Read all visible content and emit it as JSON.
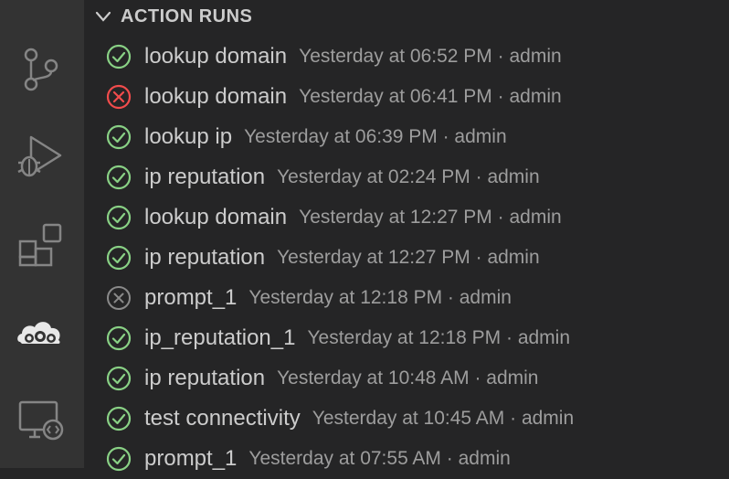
{
  "section": {
    "title": "ACTION RUNS"
  },
  "activity_bar": {
    "items": [
      {
        "icon": "source-control-icon"
      },
      {
        "icon": "run-debug-icon"
      },
      {
        "icon": "extensions-icon"
      },
      {
        "icon": "cloud-gears-icon"
      },
      {
        "icon": "remote-explorer-icon"
      }
    ]
  },
  "colors": {
    "success": "#89d185",
    "error": "#f14c4c",
    "cancelled": "#8a8a8a"
  },
  "runs": [
    {
      "name": "lookup domain",
      "meta": "Yesterday at 06:52 PM · admin",
      "status": "success"
    },
    {
      "name": "lookup domain",
      "meta": "Yesterday at 06:41 PM · admin",
      "status": "error"
    },
    {
      "name": "lookup ip",
      "meta": "Yesterday at 06:39 PM · admin",
      "status": "success"
    },
    {
      "name": "ip reputation",
      "meta": "Yesterday at 02:24 PM · admin",
      "status": "success"
    },
    {
      "name": "lookup domain",
      "meta": "Yesterday at 12:27 PM · admin",
      "status": "success"
    },
    {
      "name": "ip reputation",
      "meta": "Yesterday at 12:27 PM · admin",
      "status": "success"
    },
    {
      "name": "prompt_1",
      "meta": "Yesterday at 12:18 PM · admin",
      "status": "cancelled"
    },
    {
      "name": "ip_reputation_1",
      "meta": "Yesterday at 12:18 PM · admin",
      "status": "success"
    },
    {
      "name": "ip reputation",
      "meta": "Yesterday at 10:48 AM · admin",
      "status": "success"
    },
    {
      "name": "test connectivity",
      "meta": "Yesterday at 10:45 AM · admin",
      "status": "success"
    },
    {
      "name": "prompt_1",
      "meta": "Yesterday at 07:55 AM · admin",
      "status": "success"
    }
  ]
}
